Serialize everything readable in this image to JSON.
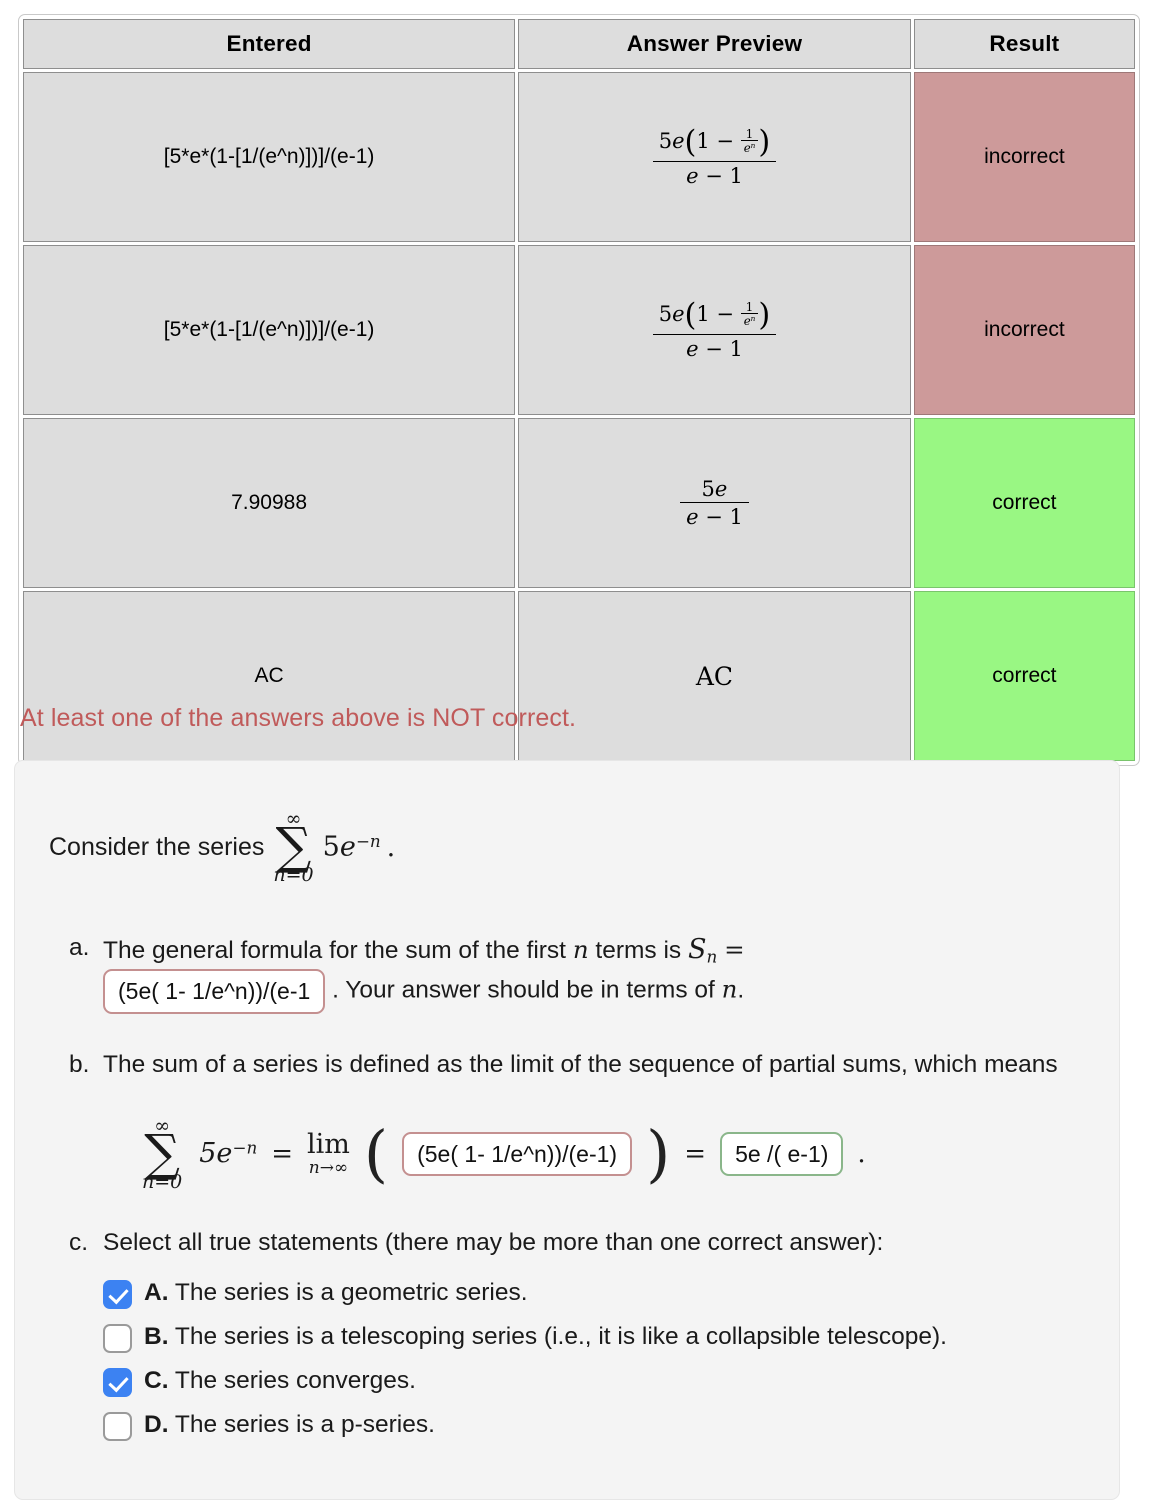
{
  "results_table": {
    "headers": [
      "Entered",
      "Answer Preview",
      "Result"
    ],
    "rows": [
      {
        "entered": "[5*e*(1-[1/(e^n)])]/(e-1)",
        "preview_type": "frac_full",
        "preview_text": "5e(1 - 1/e^n) / (e - 1)",
        "result": "incorrect",
        "result_state": "incorrect"
      },
      {
        "entered": "[5*e*(1-[1/(e^n)])]/(e-1)",
        "preview_type": "frac_full",
        "preview_text": "5e(1 - 1/e^n) / (e - 1)",
        "result": "incorrect",
        "result_state": "incorrect"
      },
      {
        "entered": "7.90988",
        "preview_type": "frac_simple",
        "preview_text": "5e / (e - 1)",
        "result": "correct",
        "result_state": "correct"
      },
      {
        "entered": "AC",
        "preview_type": "plain",
        "preview_text": "AC",
        "result": "correct",
        "result_state": "correct"
      }
    ]
  },
  "notice": "At least one of the answers above is NOT correct.",
  "problem": {
    "intro_lead": "Consider the series",
    "series": {
      "sum_top": "∞",
      "sum_bottom": "n=0",
      "term_coefficient": "5",
      "term_base": "e",
      "term_exponent": "−n",
      "trailing": "."
    },
    "parts": [
      {
        "marker": "a.",
        "text_before": "The general formula for the sum of the first",
        "var1": "n",
        "text_mid": "terms is",
        "symbol": "S",
        "symbol_sub": "n",
        "equals": "=",
        "answer_value": "(5e( 1- 1/e^n))/(e-1",
        "answer_state": "red",
        "text_after_1": ". Your answer should be in terms of",
        "var2": "n",
        "text_after_2": "."
      },
      {
        "marker": "b.",
        "text": "The sum of a series is defined as the limit of the sequence of partial sums, which means",
        "equation": {
          "sum_top": "∞",
          "sum_bottom": "n=0",
          "term": "5e",
          "term_exponent": "−n",
          "equals1": "=",
          "lim_label": "lim",
          "lim_sub": "n→∞",
          "open_paren": "(",
          "answer_inner": "(5e( 1- 1/e^n))/(e-1)",
          "answer_inner_state": "red",
          "close_paren": ")",
          "equals2": "=",
          "answer_result": "5e /( e-1)",
          "answer_result_state": "green",
          "period": "."
        }
      },
      {
        "marker": "c.",
        "text": "Select all true statements (there may be more than one correct answer):",
        "choices": [
          {
            "letter": "A.",
            "label": "The series is a geometric series.",
            "checked": true
          },
          {
            "letter": "B.",
            "label": "The series is a telescoping series (i.e., it is like a collapsible telescope).",
            "checked": false
          },
          {
            "letter": "C.",
            "label": "The series converges.",
            "checked": true
          },
          {
            "letter": "D.",
            "label": "The series is a p-series.",
            "checked": false
          }
        ]
      }
    ]
  },
  "colors": {
    "incorrect_bg": "#cd9a9a",
    "correct_bg": "#99f783",
    "result_text": "#1b2f8a",
    "notice_text": "#c05a5a",
    "checkbox_on": "#3c82f2",
    "answer_border_red": "#c49090",
    "answer_border_green": "#8ab68a",
    "table_cell_bg": "#dddddd",
    "panel_bg": "#f4f4f4"
  }
}
